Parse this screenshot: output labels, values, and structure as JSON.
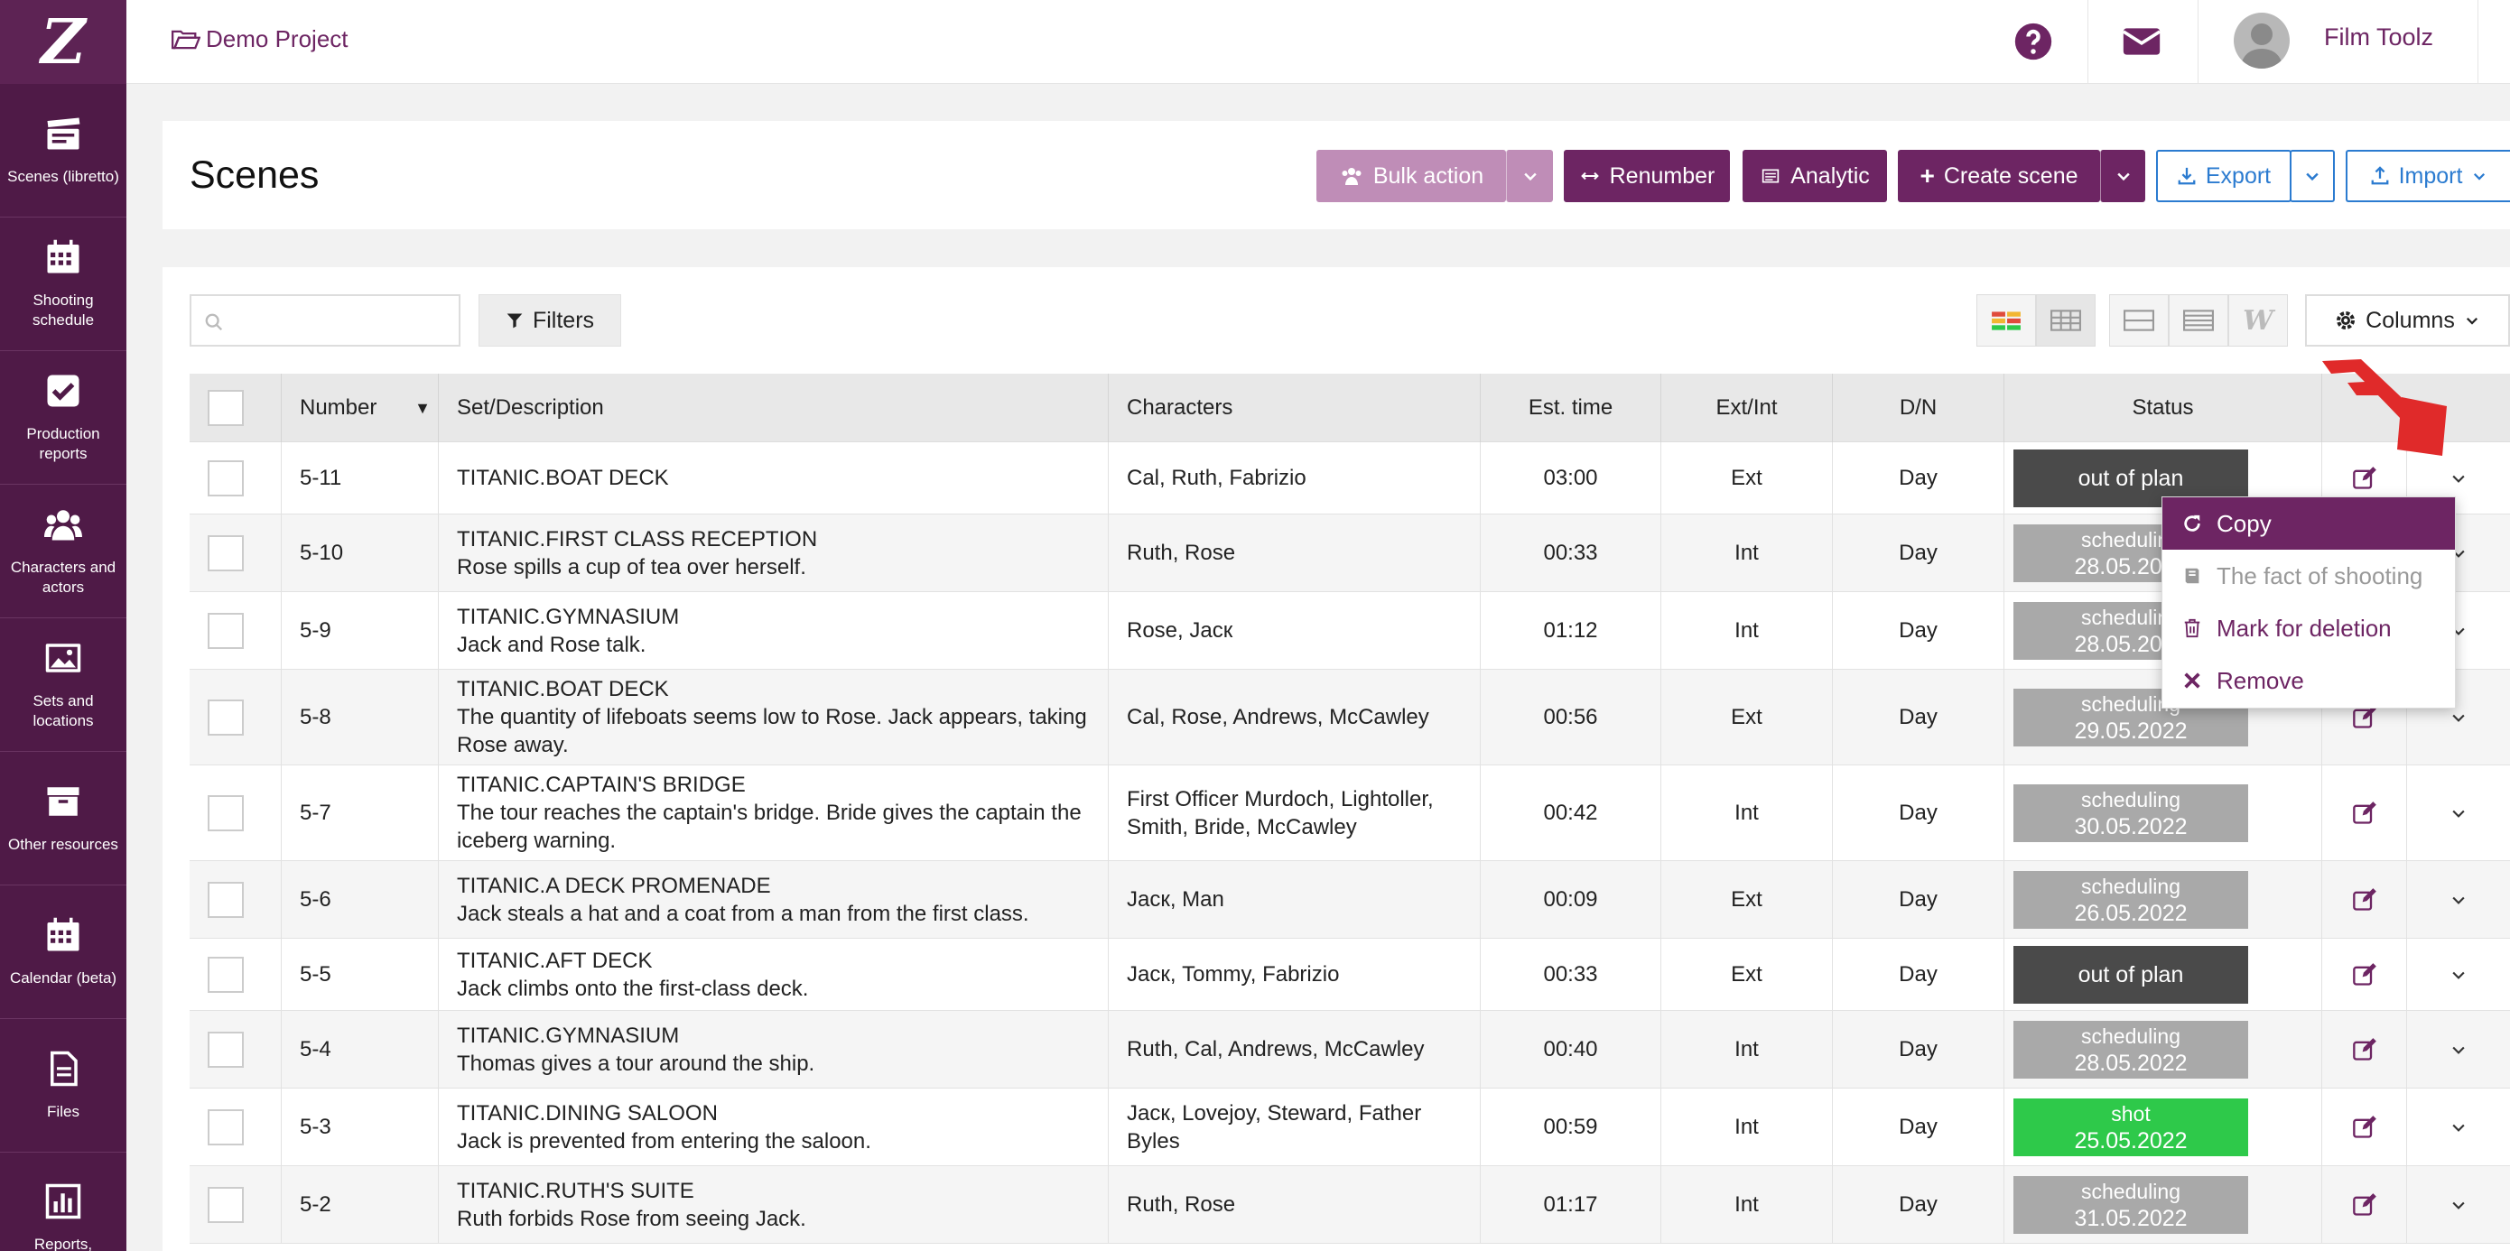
{
  "sidebar": {
    "logo": "Z",
    "items": [
      {
        "label": "Scenes (libretto)",
        "icon": "clapperboard-icon"
      },
      {
        "label": "Shooting schedule",
        "icon": "calendar-icon"
      },
      {
        "label": "Production reports",
        "icon": "check-square-icon"
      },
      {
        "label": "Characters and actors",
        "icon": "users-icon"
      },
      {
        "label": "Sets and locations",
        "icon": "image-icon"
      },
      {
        "label": "Other resources",
        "icon": "archive-icon"
      },
      {
        "label": "Calendar (beta)",
        "icon": "calendar-grid-icon"
      },
      {
        "label": "Files",
        "icon": "file-icon"
      },
      {
        "label": "Reports,",
        "icon": "bar-chart-icon"
      }
    ]
  },
  "topbar": {
    "project": "Demo Project",
    "user_name": "Film Toolz"
  },
  "header": {
    "title": "Scenes",
    "bulk_action": "Bulk action",
    "renumber": "Renumber",
    "analytic": "Analytic",
    "create_scene": "Create scene",
    "export": "Export",
    "import": "Import"
  },
  "toolbar": {
    "search_placeholder": "",
    "filters": "Filters",
    "columns": "Columns"
  },
  "table": {
    "headers": {
      "number": "Number",
      "set_description": "Set/Description",
      "characters": "Characters",
      "est_time": "Est. time",
      "ext_int": "Ext/Int",
      "dn": "D/N",
      "status": "Status"
    },
    "rows": [
      {
        "number": "5-11",
        "set": "TITANIC.BOAT DECK",
        "desc": "",
        "characters": "Cal, Ruth, Fabrizio",
        "time": "03:00",
        "ext_int": "Ext",
        "dn": "Day",
        "status": "out of plan",
        "date": "",
        "status_color": "#4a4a4a"
      },
      {
        "number": "5-10",
        "set": "TITANIC.FIRST CLASS RECEPTION",
        "desc": "Rose spills a cup of tea over herself.",
        "characters": "Ruth, Rose",
        "time": "00:33",
        "ext_int": "Int",
        "dn": "Day",
        "status": "scheduling",
        "date": "28.05.2022",
        "status_color": "#a9a9a9"
      },
      {
        "number": "5-9",
        "set": "TITANIC.GYMNASIUM",
        "desc": "Jack and Rose talk.",
        "characters": "Rose, Jacк",
        "time": "01:12",
        "ext_int": "Int",
        "dn": "Day",
        "status": "scheduling",
        "date": "28.05.2022",
        "status_color": "#a9a9a9"
      },
      {
        "number": "5-8",
        "set": "TITANIC.BOAT DECK",
        "desc": "The quantity of lifeboats seems low to Rose. Jack appears, taking Rose away.",
        "characters": "Cal, Rose, Andrews, McCawley",
        "time": "00:56",
        "ext_int": "Ext",
        "dn": "Day",
        "status": "scheduling",
        "date": "29.05.2022",
        "status_color": "#a9a9a9"
      },
      {
        "number": "5-7",
        "set": "TITANIC.CAPTAIN'S BRIDGE",
        "desc": "The tour reaches the captain's bridge. Bride gives the captain the iceberg warning.",
        "characters": "First Officer Murdoch, Lightoller, Smith, Bride, McCawley",
        "time": "00:42",
        "ext_int": "Int",
        "dn": "Day",
        "status": "scheduling",
        "date": "30.05.2022",
        "status_color": "#a9a9a9"
      },
      {
        "number": "5-6",
        "set": "TITANIC.A DECK PROMENADE",
        "desc": "Jack steals a hat and a coat from a man from the first class.",
        "characters": "Jacк, Man",
        "time": "00:09",
        "ext_int": "Ext",
        "dn": "Day",
        "status": "scheduling",
        "date": "26.05.2022",
        "status_color": "#a9a9a9"
      },
      {
        "number": "5-5",
        "set": "TITANIC.AFT DECK",
        "desc": "Jack climbs onto the first-class deck.",
        "characters": "Jacк, Tommy, Fabrizio",
        "time": "00:33",
        "ext_int": "Ext",
        "dn": "Day",
        "status": "out of plan",
        "date": "",
        "status_color": "#4a4a4a"
      },
      {
        "number": "5-4",
        "set": "TITANIC.GYMNASIUM",
        "desc": "Thomas gives a tour around the ship.",
        "characters": "Ruth, Cal, Andrews, McCawley",
        "time": "00:40",
        "ext_int": "Int",
        "dn": "Day",
        "status": "scheduling",
        "date": "28.05.2022",
        "status_color": "#a9a9a9"
      },
      {
        "number": "5-3",
        "set": "TITANIC.DINING SALOON",
        "desc": "Jack is prevented from entering the saloon.",
        "characters": "Jacк, Lovejoy, Steward, Father Byles",
        "time": "00:59",
        "ext_int": "Int",
        "dn": "Day",
        "status": "shot",
        "date": "25.05.2022",
        "status_color": "#2ec94a"
      },
      {
        "number": "5-2",
        "set": "TITANIC.RUTH'S SUITE",
        "desc": "Ruth forbids Rose from seeing Jack.",
        "characters": "Ruth, Rose",
        "time": "01:17",
        "ext_int": "Int",
        "dn": "Day",
        "status": "scheduling",
        "date": "31.05.2022",
        "status_color": "#a9a9a9"
      }
    ]
  },
  "dropdown": {
    "copy": "Copy",
    "fact": "The fact of shooting",
    "mark": "Mark for deletion",
    "remove": "Remove"
  },
  "colors": {
    "brand": "#6d2563",
    "sidebar": "#4f1a47",
    "accent_blue": "#2b7bd0",
    "shot_green": "#2ec94a"
  }
}
